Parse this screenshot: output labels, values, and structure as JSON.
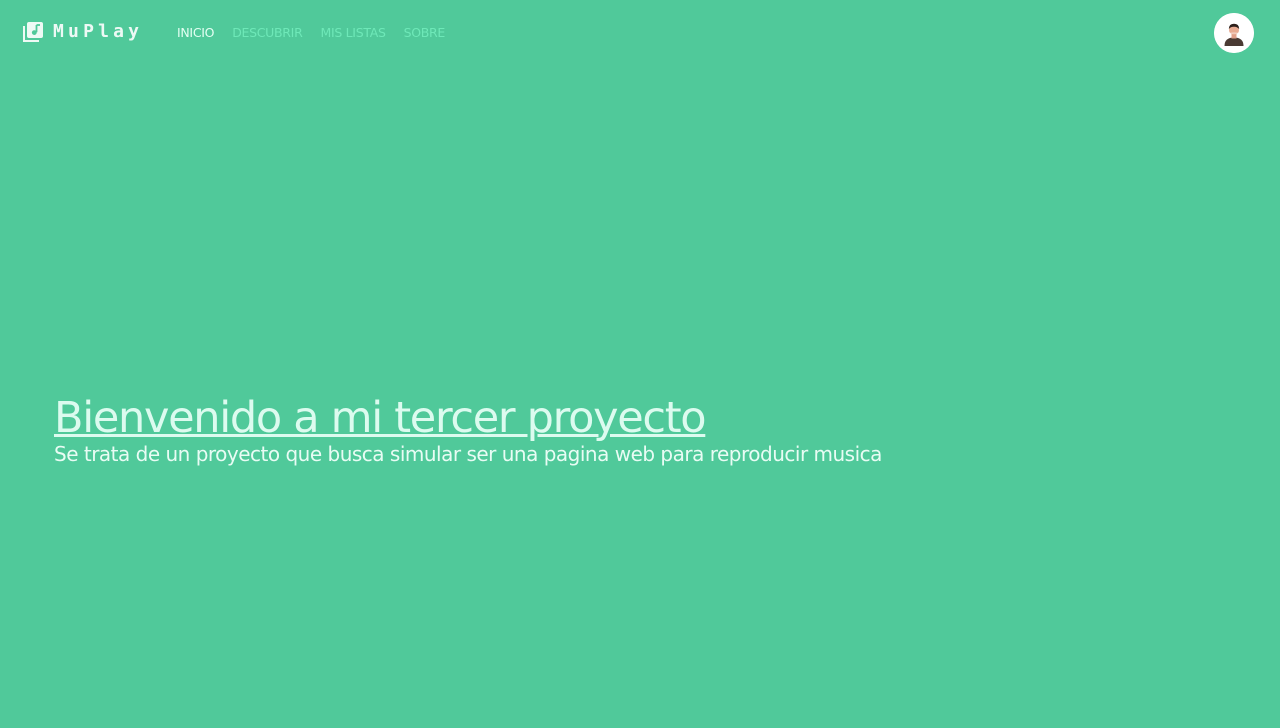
{
  "brand": {
    "name": "MuPlay",
    "icon": "music-library-icon"
  },
  "nav": {
    "items": [
      {
        "label": "INICIO",
        "active": true
      },
      {
        "label": "DESCUBRIR",
        "active": false
      },
      {
        "label": "MIS LISTAS",
        "active": false
      },
      {
        "label": "SOBRE",
        "active": false
      }
    ]
  },
  "user": {
    "avatar_icon": "user-avatar-icon"
  },
  "hero": {
    "title": "Bienvenido a mi tercer proyecto",
    "subtitle": "Se trata de un proyecto que busca simular ser una pagina web para reproducir musica"
  },
  "colors": {
    "background": "#50c99a",
    "nav_inactive": "#6ee8b8",
    "nav_active": "#e4fff3",
    "hero_text": "#dcfbef"
  }
}
